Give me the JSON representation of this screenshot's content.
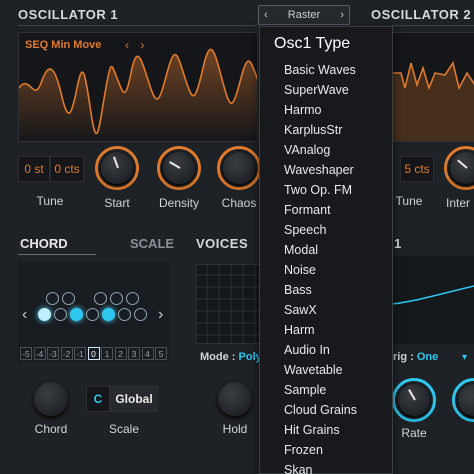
{
  "osc1": {
    "title": "OSCILLATOR 1",
    "wave_label": "SEQ Min Move",
    "wave_arrows": "‹ ›",
    "tune_st": "0 st",
    "tune_cts": "0 cts",
    "knob_labels": [
      "Tune",
      "Start",
      "Density",
      "Chaos"
    ]
  },
  "osc2": {
    "title": "OSCILLATOR 2",
    "tune_cts": "5 cts",
    "knob_labels": [
      "Tune",
      "Inter"
    ]
  },
  "selector": {
    "left_arrow": "‹",
    "value": "Raster",
    "right_arrow": "›"
  },
  "menu": {
    "title": "Osc1 Type",
    "items": [
      "Basic Waves",
      "SuperWave",
      "Harmo",
      "KarplusStr",
      "VAnalog",
      "Waveshaper",
      "Two Op. FM",
      "Formant",
      "Speech",
      "Modal",
      "Noise",
      "Bass",
      "SawX",
      "Harm",
      "Audio In",
      "Wavetable",
      "Sample",
      "Cloud Grains",
      "Hit Grains",
      "Frozen",
      "Skan"
    ]
  },
  "chord": {
    "tab_chord": "CHORD",
    "tab_scale": "SCALE",
    "left_arrow": "‹",
    "right_arrow": "›",
    "scale_numbers": [
      "-5",
      "-4",
      "-3",
      "-2",
      "-1",
      "0",
      "1",
      "2",
      "3",
      "4",
      "5"
    ],
    "selected_scale": "0",
    "key": "C",
    "scope": "Global",
    "knob_labels": [
      "Chord",
      "Scale"
    ]
  },
  "voices": {
    "title": "VOICES",
    "mode_label": "Mode :",
    "mode_value": "Poly",
    "knob_label": "Hold"
  },
  "right_panel": {
    "title_fragment": "1",
    "trig_label": "rig :",
    "trig_value": "One",
    "knob_label": "Rate"
  },
  "colors": {
    "accent_orange": "#e07a2e",
    "accent_cyan": "#2fc8f0",
    "background": "#1e2226"
  }
}
